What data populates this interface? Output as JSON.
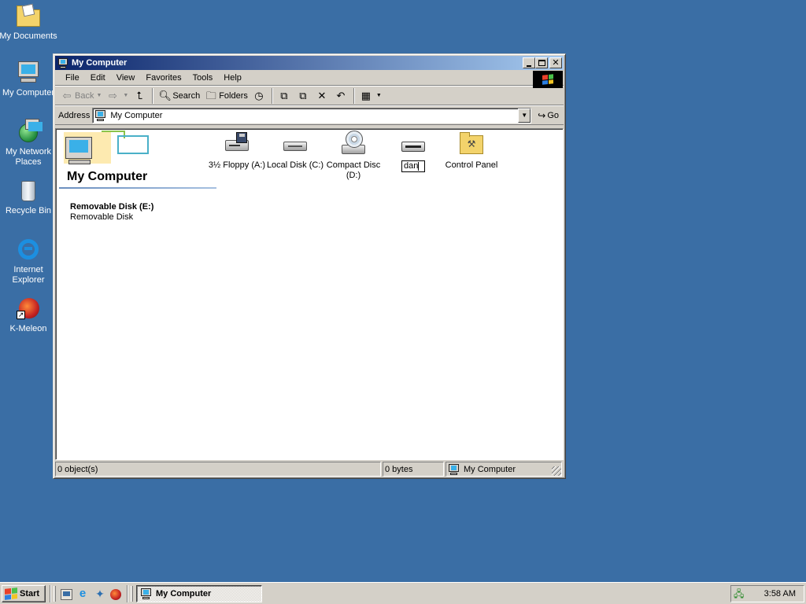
{
  "desktop": {
    "background_color": "#3a6ea5",
    "icons": [
      {
        "label": "My Documents",
        "icon": "my-documents-icon"
      },
      {
        "label": "My Computer",
        "icon": "my-computer-icon"
      },
      {
        "label": "My Network Places",
        "icon": "network-places-icon"
      },
      {
        "label": "Recycle Bin",
        "icon": "recycle-bin-icon"
      },
      {
        "label": "Internet Explorer",
        "icon": "internet-explorer-icon"
      },
      {
        "label": "K-Meleon",
        "icon": "k-meleon-icon"
      }
    ]
  },
  "window": {
    "title": "My Computer",
    "title_bar_color": "#0a246a",
    "controls": {
      "minimize": "0",
      "maximize": "1",
      "close": "r"
    },
    "menu": [
      "File",
      "Edit",
      "View",
      "Favorites",
      "Tools",
      "Help"
    ],
    "toolbar": {
      "back": "Back",
      "search": "Search",
      "folders": "Folders"
    },
    "address": {
      "label": "Address",
      "value": "My Computer",
      "go": "Go"
    },
    "webview": {
      "title": "My Computer",
      "selected_name": "Removable Disk (E:)",
      "selected_type": "Removable Disk"
    },
    "items": [
      {
        "label": "3½ Floppy (A:)",
        "icon": "floppy-drive-icon"
      },
      {
        "label": "Local Disk (C:)",
        "icon": "hard-disk-icon"
      },
      {
        "label": "Compact Disc (D:)",
        "icon": "cd-drive-icon"
      },
      {
        "label": "dan",
        "icon": "removable-disk-icon",
        "renaming": true
      },
      {
        "label": "Control Panel",
        "icon": "control-panel-icon"
      }
    ],
    "status": {
      "objects": "0 object(s)",
      "size": "0 bytes",
      "zone": "My Computer"
    }
  },
  "taskbar": {
    "start_label": "Start",
    "task_label": "My Computer",
    "clock": "3:58 AM"
  }
}
